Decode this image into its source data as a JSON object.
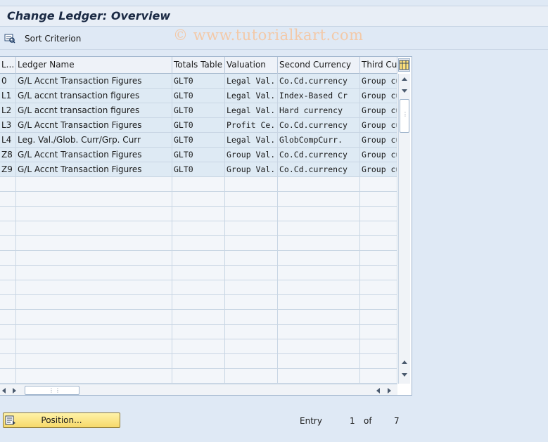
{
  "window": {
    "title": "Change Ledger: Overview"
  },
  "toolbar": {
    "sort_label": "Sort Criterion",
    "sort_icon": "sort-icon"
  },
  "watermark": "© www.tutorialkart.com",
  "table": {
    "columns": [
      "L...",
      "Ledger Name",
      "Totals Table",
      "Valuation",
      "Second Currency",
      "Third Cur"
    ],
    "rows": [
      [
        "0",
        "G/L Accnt Transaction Figures",
        "GLT0",
        "Legal Val...",
        "Co.Cd.currency",
        "Group cu"
      ],
      [
        "L1",
        "G/L accnt transaction figures",
        "GLT0",
        "Legal Val...",
        "Index-Based Cr",
        "Group cu"
      ],
      [
        "L2",
        "G/L accnt transaction figures",
        "GLT0",
        "Legal Val...",
        "Hard currency",
        "Group cu"
      ],
      [
        "L3",
        "G/L Accnt Transaction Figures",
        "GLT0",
        "Profit Ce...",
        "Co.Cd.currency",
        "Group cu"
      ],
      [
        "L4",
        "Leg. Val./Glob. Curr/Grp. Curr",
        "GLT0",
        "Legal Val...",
        "GlobCompCurr.",
        "Group cu"
      ],
      [
        "Z8",
        "G/L Accnt Transaction Figures",
        "GLT0",
        "Group Val...",
        "Co.Cd.currency",
        "Group cu"
      ],
      [
        "Z9",
        "G/L Accnt Transaction Figures",
        "GLT0",
        "Group Val...",
        "Co.Cd.currency",
        "Group cu"
      ]
    ]
  },
  "footer": {
    "position_label": "Position...",
    "entry_label": "Entry",
    "entry_current": "1",
    "of_label": "of",
    "entry_total": "7"
  },
  "colors": {
    "button_yellow": "#f6d96a",
    "row_fill": "#deeaf4",
    "background": "#dfe9f5"
  }
}
